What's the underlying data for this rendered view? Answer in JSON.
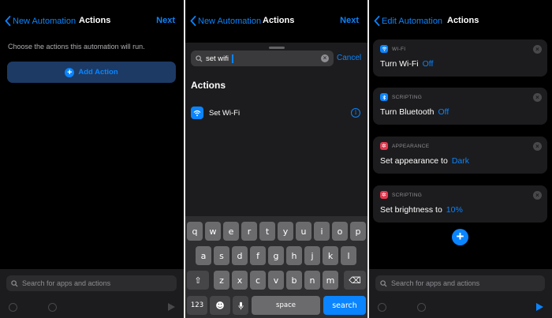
{
  "panel1": {
    "nav": {
      "back_label": "New Automation",
      "title": "Actions",
      "next_label": "Next"
    },
    "hint": "Choose the actions this automation will run.",
    "add_action_label": "Add Action",
    "bottom_search_placeholder": "Search for apps and actions"
  },
  "panel2": {
    "nav": {
      "back_label": "New Automation",
      "title": "Actions",
      "next_label": "Next"
    },
    "search_value": "set wifi",
    "cancel_label": "Cancel",
    "section_title": "Actions",
    "results": [
      {
        "label": "Set Wi-Fi",
        "icon": "wifi-icon"
      }
    ],
    "keyboard": {
      "row1": [
        "q",
        "w",
        "e",
        "r",
        "t",
        "y",
        "u",
        "i",
        "o",
        "p"
      ],
      "row2": [
        "a",
        "s",
        "d",
        "f",
        "g",
        "h",
        "j",
        "k",
        "l"
      ],
      "row3": [
        "z",
        "x",
        "c",
        "v",
        "b",
        "n",
        "m"
      ],
      "shift": "⇧",
      "delete": "⌫",
      "numbers": "123",
      "emoji": "☻",
      "mic": "mic-icon",
      "space": "space",
      "search": "search"
    }
  },
  "panel3": {
    "nav": {
      "back_label": "Edit Automation",
      "title": "Actions"
    },
    "cards": [
      {
        "category": "WI-FI",
        "icon": "wifi-icon",
        "icon_color": "#0a84ff",
        "text": "Turn Wi-Fi",
        "value": "Off"
      },
      {
        "category": "SCRIPTING",
        "icon": "bluetooth-icon",
        "icon_color": "#0a84ff",
        "text": "Turn Bluetooth",
        "value": "Off"
      },
      {
        "category": "APPEARANCE",
        "icon": "appearance-icon",
        "icon_color": "#e2394f",
        "text": "Set appearance to",
        "value": "Dark"
      },
      {
        "category": "SCRIPTING",
        "icon": "brightness-icon",
        "icon_color": "#e2394f",
        "text": "Set brightness to",
        "value": "10%"
      }
    ],
    "bottom_search_placeholder": "Search for apps and actions"
  },
  "colors": {
    "accent": "#0a84ff",
    "background": "#000000",
    "card": "#1c1c1e",
    "pink": "#e2394f"
  }
}
